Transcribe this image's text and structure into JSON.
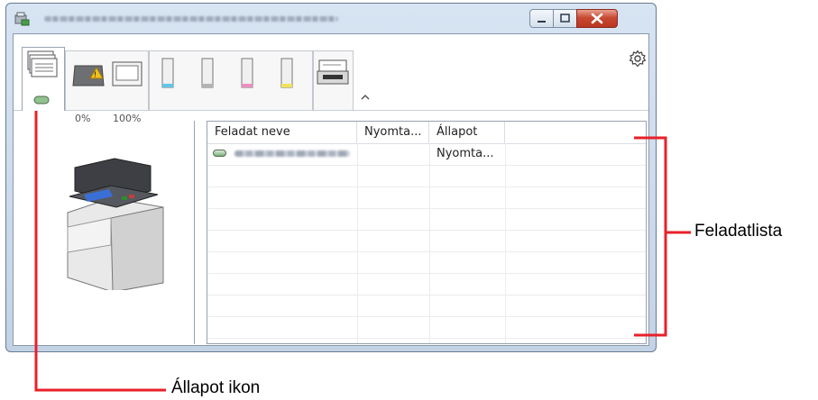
{
  "window": {
    "controls": {
      "minimize": "minimize",
      "maximize": "maximize",
      "close": "close"
    }
  },
  "toolbar": {
    "toner_low": "0%",
    "paper_full": "100%",
    "icons": [
      "printer-queue-icon",
      "toner-warning-icon",
      "paper-tray-icon",
      "cyan-toner-icon",
      "magenta-toner-icon",
      "yellow-toner-icon",
      "black-toner-icon",
      "scanner-icon",
      "gear-icon",
      "collapse-icon"
    ]
  },
  "job_list": {
    "columns": [
      "Feladat neve",
      "Nyomta...",
      "Állapot"
    ],
    "rows": [
      {
        "name": "",
        "printed": "",
        "status": "Nyomta..."
      }
    ],
    "empty_rows": 8
  },
  "callouts": {
    "job_list": "Feladatlista",
    "status_icon": "Állapot ikon"
  },
  "colors": {
    "callout": "#e8202a",
    "status_ok": "#7bb07a",
    "warning": "#f2c01d"
  }
}
